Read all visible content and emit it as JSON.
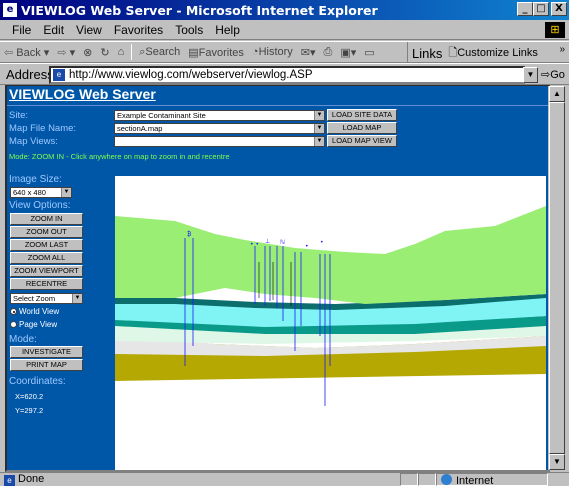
{
  "window": {
    "title": "VIEWLOG Web Server - Microsoft Internet Explorer",
    "controls": [
      "_",
      "□",
      "X"
    ]
  },
  "menu": [
    "File",
    "Edit",
    "View",
    "Favorites",
    "Tools",
    "Help"
  ],
  "toolbar": {
    "back": "Back",
    "search": "Search",
    "favorites": "Favorites",
    "history": "History",
    "links_label": "Links",
    "links_item": "Customize Links"
  },
  "address": {
    "label": "Address",
    "url": "http://www.viewlog.com/webserver/viewlog.ASP",
    "go": "Go"
  },
  "page": {
    "header": "VIEWLOG Web Server",
    "site_label": "Site:",
    "site_value": "Example Contaminant Site",
    "mapfile_label": "Map File Name:",
    "mapfile_value": "sectionA.map",
    "mapviews_label": "Map Views:",
    "mapviews_value": "",
    "load_site_data": "LOAD SITE DATA",
    "load_map": "LOAD MAP",
    "load_map_view": "LOAD MAP VIEW",
    "mode_line": "Mode: ZOOM IN  - Click anywhere on map to zoom in and recentre",
    "image_size_label": "Image Size:",
    "image_size_value": "640 x 480",
    "view_options_label": "View Options:",
    "buttons": [
      "ZOOM IN",
      "ZOOM OUT",
      "ZOOM LAST",
      "ZOOM ALL",
      "ZOOM VIEWPORT",
      "RECENTRE"
    ],
    "select_zoom": "Select Zoom",
    "world_view": "World View",
    "page_view": "Page View",
    "mode_label": "Mode:",
    "investigate": "INVESTIGATE",
    "print_map": "PRINT MAP",
    "coordinates_label": "Coordinates:",
    "x_coord": "X=620.2",
    "y_coord": "Y=297.2"
  },
  "status": {
    "text": "Done",
    "zone": "Internet"
  },
  "colors": {
    "page_bg": "#0057a8",
    "title_start": "#000080",
    "title_end": "#1084d0",
    "mode_text": "#7cff4a",
    "label_text": "#9ec8ff"
  },
  "map_layers": [
    {
      "name": "top-layer",
      "color": "#9aee74"
    },
    {
      "name": "thin-band-1",
      "color": "#0c6d6d"
    },
    {
      "name": "aquifer-cyan",
      "color": "#80f4f4"
    },
    {
      "name": "thin-band-2",
      "color": "#0a9a8a"
    },
    {
      "name": "pale-band",
      "color": "#dff7e6"
    },
    {
      "name": "grey-band",
      "color": "#e6e6e6"
    },
    {
      "name": "olive-base",
      "color": "#b5a803"
    }
  ]
}
